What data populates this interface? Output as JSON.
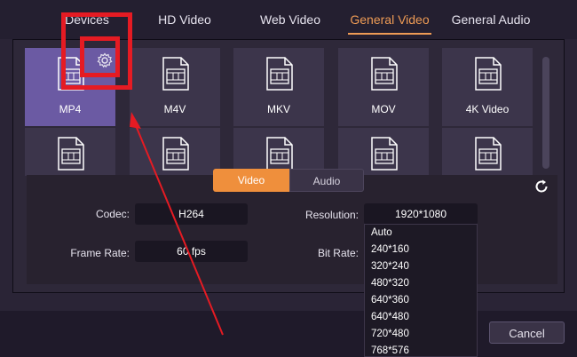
{
  "tabs": [
    {
      "label": "Devices"
    },
    {
      "label": "HD Video"
    },
    {
      "label": "Web Video"
    },
    {
      "label": "General Video"
    },
    {
      "label": "General Audio"
    }
  ],
  "active_tab": "General Video",
  "formats_row1": [
    {
      "label": "MP4",
      "selected": true,
      "icon": "film-file-icon"
    },
    {
      "label": "M4V",
      "icon": "film-file-icon"
    },
    {
      "label": "MKV",
      "icon": "film-file-icon"
    },
    {
      "label": "MOV",
      "icon": "film-file-icon"
    },
    {
      "label": "4K Video",
      "icon": "film-file-icon"
    }
  ],
  "settings": {
    "tabs": {
      "video": "Video",
      "audio": "Audio"
    },
    "active": "Video",
    "codec": {
      "label": "Codec:",
      "value": "H264"
    },
    "frame_rate": {
      "label": "Frame Rate:",
      "value": "60 fps"
    },
    "resolution": {
      "label": "Resolution:",
      "value": "1920*1080"
    },
    "bit_rate": {
      "label": "Bit Rate:"
    }
  },
  "resolution_options": [
    "Auto",
    "240*160",
    "320*240",
    "480*320",
    "640*360",
    "640*480",
    "720*480",
    "768*576"
  ],
  "footer": {
    "cancel": "Cancel"
  },
  "colors": {
    "accent": "#ee9b55",
    "selected_tile": "#6b5aa3",
    "annotation": "#e51b23"
  },
  "icons": [
    "gear-icon",
    "reset-icon",
    "film-file-icon"
  ]
}
